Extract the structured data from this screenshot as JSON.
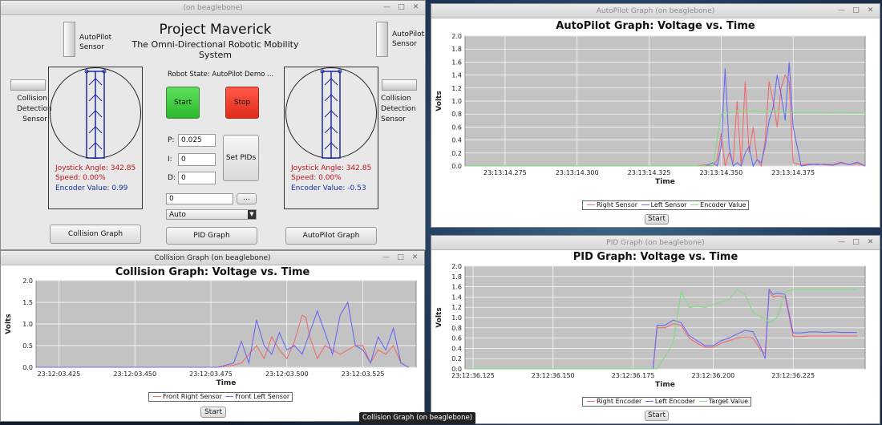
{
  "main": {
    "window_title": "(on beaglebone)",
    "title": "Project Maverick",
    "subtitle": "The Omni-Directional Robotic Mobility System",
    "left_sensor_label": "AutoPilot\nSensor",
    "right_sensor_label": "AutoPilot\nSensor",
    "collision_left": "Collision\nDetection\nSensor",
    "collision_right": "Collision\nDetection\nSensor",
    "robot_state": "Robot State: AutoPilot Demo ...",
    "start_label": "Start",
    "stop_label": "Stop",
    "p_label": "P:",
    "p_value": "0.025",
    "i_label": "I:",
    "i_value": "0",
    "d_label": "D:",
    "d_value": "0",
    "set_pids": "Set PIDs",
    "command_value": "0",
    "ellipsis": "...",
    "mode_value": "Auto",
    "left_joystick": "Joystick Angle: 342.85",
    "left_speed": "Speed: 0.00%",
    "left_encoder": "Encoder Value: 0.99",
    "right_joystick": "Joystick Angle: 342.85",
    "right_speed": "Speed: 0.00%",
    "right_encoder": "Encoder Value: -0.53",
    "collision_graph_btn": "Collision Graph",
    "pid_graph_btn": "PID Graph",
    "autopilot_graph_btn": "AutoPilot Graph"
  },
  "autopilot_window": {
    "title": "AutoPilot Graph (on beaglebone)",
    "start_label": "Start"
  },
  "pid_window": {
    "title": "PID Graph (on beaglebone)",
    "start_label": "Start"
  },
  "collision_window": {
    "title": "Collision Graph (on beaglebone)",
    "start_label": "Start"
  },
  "taskbar_tooltip": "Collision Graph (on beaglebone)",
  "colors": {
    "red": "#f06c6c",
    "blue": "#6a6af5",
    "green": "#7ce07c",
    "plot_bg": "#c3c3c3"
  },
  "chart_data": [
    {
      "id": "autopilot",
      "type": "line",
      "title": "AutoPilot Graph: Voltage vs. Time",
      "xlabel": "Time",
      "ylabel": "Volts",
      "ylim": [
        0,
        2.0
      ],
      "yticks": [
        "0.0",
        "0.2",
        "0.4",
        "0.6",
        "0.8",
        "1.0",
        "1.2",
        "1.4",
        "1.6",
        "1.8",
        "2.0"
      ],
      "xticks": [
        "23:13:14.275",
        "23:13:14.300",
        "23:13:14.325",
        "23:13:14.350",
        "23:13:14.375"
      ],
      "xlim": [
        0,
        100
      ],
      "xtick_pos": [
        10,
        28,
        46,
        64,
        82
      ],
      "series": [
        {
          "name": "Right Sensor",
          "color": "#f06c6c",
          "x": [
            0,
            55,
            58,
            60,
            62,
            63,
            64,
            65,
            66,
            67,
            68,
            69,
            70,
            71,
            72,
            73,
            74,
            75,
            76,
            77,
            78,
            79,
            80,
            81,
            82,
            84,
            86,
            88,
            90,
            92,
            94,
            96,
            98,
            100
          ],
          "y": [
            0,
            0,
            0,
            0.02,
            0,
            0.1,
            0.5,
            0,
            0.2,
            0.05,
            1.0,
            0,
            1.3,
            0.2,
            0.6,
            0.1,
            0,
            0.4,
            1.3,
            1.0,
            0.6,
            1.2,
            1.4,
            1.3,
            0.05,
            0.02,
            0.03,
            0.02,
            0.03,
            0.02,
            0.06,
            0.02,
            0.04,
            0
          ]
        },
        {
          "name": "Left Sensor",
          "color": "#6a6af5",
          "x": [
            0,
            55,
            60,
            62,
            63,
            64,
            65,
            66,
            67,
            68,
            69,
            70,
            71,
            72,
            73,
            74,
            75,
            76,
            77,
            78,
            79,
            80,
            81,
            82,
            84,
            86,
            88,
            90,
            92,
            94,
            96,
            98,
            100
          ],
          "y": [
            0,
            0,
            0,
            0.05,
            0,
            0.3,
            1.5,
            0.3,
            0,
            0.05,
            0,
            0.2,
            0.3,
            0,
            0.1,
            0.05,
            0.3,
            0.7,
            0.9,
            1.4,
            1.1,
            0.7,
            1.6,
            0.6,
            0,
            0.02,
            0.03,
            0.02,
            0.01,
            0.05,
            0.02,
            0.06,
            0
          ]
        },
        {
          "name": "Encoder Value",
          "color": "#7ce07c",
          "x": [
            0,
            55,
            58,
            60,
            62,
            64,
            66,
            68,
            70,
            72,
            74,
            76,
            78,
            80,
            82,
            84,
            86,
            88,
            90,
            92,
            94,
            96,
            98,
            100
          ],
          "y": [
            0,
            0,
            0,
            0,
            0,
            0.8,
            0.82,
            0.85,
            0.84,
            0.85,
            0.83,
            0.85,
            0.84,
            0.83,
            0.82,
            0.83,
            0.82,
            0.83,
            0.82,
            0.82,
            0.83,
            0.82,
            0.82,
            0.82
          ]
        }
      ]
    },
    {
      "id": "pid",
      "type": "line",
      "title": "PID Graph: Voltage vs. Time",
      "xlabel": "Time",
      "ylabel": "Volts",
      "ylim": [
        0,
        2.0
      ],
      "yticks": [
        "0.0",
        "0.2",
        "0.4",
        "0.6",
        "0.8",
        "1.0",
        "1.2",
        "1.4",
        "1.6",
        "1.8",
        "2.0"
      ],
      "xticks": [
        "23:12:36.125",
        "23:12:36.150",
        "23:12:36.175",
        "23:12:36.200",
        "23:12:36.225"
      ],
      "xlim": [
        0,
        100
      ],
      "xtick_pos": [
        2,
        22,
        42,
        62,
        82
      ],
      "series": [
        {
          "name": "Right Encoder",
          "color": "#f06c6c",
          "x": [
            0,
            47,
            48,
            50,
            52,
            54,
            56,
            58,
            60,
            62,
            64,
            66,
            68,
            70,
            72,
            74,
            75,
            76,
            77,
            78,
            80,
            82,
            84,
            86,
            88,
            90,
            92,
            94,
            96,
            98
          ],
          "y": [
            0,
            0,
            0.8,
            0.8,
            0.88,
            0.85,
            0.6,
            0.5,
            0.42,
            0.42,
            0.5,
            0.55,
            0.6,
            0.62,
            0.6,
            0.35,
            0.3,
            1.5,
            1.4,
            1.42,
            1.4,
            0.63,
            0.63,
            0.64,
            0.64,
            0.64,
            0.64,
            0.64,
            0.64,
            0.64
          ]
        },
        {
          "name": "Left Encoder",
          "color": "#6a6af5",
          "x": [
            0,
            47,
            48,
            50,
            52,
            54,
            56,
            58,
            60,
            62,
            64,
            66,
            68,
            70,
            72,
            74,
            75,
            76,
            77,
            78,
            80,
            82,
            84,
            86,
            88,
            90,
            92,
            94,
            96,
            98
          ],
          "y": [
            0,
            0,
            0.85,
            0.85,
            0.95,
            0.9,
            0.65,
            0.55,
            0.45,
            0.45,
            0.55,
            0.6,
            0.68,
            0.75,
            0.72,
            0.4,
            0.2,
            1.55,
            1.45,
            1.48,
            1.45,
            0.7,
            0.7,
            0.72,
            0.72,
            0.71,
            0.72,
            0.71,
            0.71,
            0.71
          ]
        },
        {
          "name": "Target Value",
          "color": "#7ce07c",
          "x": [
            0,
            47,
            48,
            52,
            54,
            56,
            58,
            60,
            62,
            64,
            66,
            68,
            70,
            72,
            74,
            75,
            76,
            78,
            80,
            82,
            84,
            86,
            88,
            90,
            92,
            94,
            96,
            98
          ],
          "y": [
            0,
            0,
            0,
            0.5,
            1.5,
            1.2,
            1.22,
            1.2,
            1.25,
            1.3,
            1.35,
            1.55,
            1.45,
            1.1,
            1.0,
            1.0,
            0.9,
            1.0,
            1.5,
            1.55,
            1.55,
            1.55,
            1.55,
            1.55,
            1.55,
            1.55,
            1.55,
            1.55
          ]
        }
      ]
    },
    {
      "id": "collision",
      "type": "line",
      "title": "Collision Graph: Voltage vs. Time",
      "xlabel": "Time",
      "ylabel": "Volts",
      "ylim": [
        0,
        2.0
      ],
      "yticks": [
        "0.0",
        "0.5",
        "1.0",
        "1.5",
        "2.0"
      ],
      "xticks": [
        "23:12:03.425",
        "23:12:03.450",
        "23:12:03.475",
        "23:12:03.500",
        "23:12:03.525"
      ],
      "xlim": [
        0,
        100
      ],
      "xtick_pos": [
        6,
        26,
        46,
        66,
        86
      ],
      "series": [
        {
          "name": "Front Right Sensor",
          "color": "#f06c6c",
          "x": [
            0,
            48,
            52,
            54,
            56,
            58,
            60,
            62,
            64,
            66,
            68,
            70,
            71,
            72,
            74,
            76,
            78,
            80,
            82,
            84,
            86,
            88,
            90,
            92,
            94,
            96,
            98
          ],
          "y": [
            0,
            0,
            0.05,
            0.1,
            0.3,
            0.5,
            0.2,
            0.7,
            0.4,
            0.2,
            0.6,
            1.2,
            1.15,
            0.7,
            0.2,
            0.5,
            0.4,
            0.3,
            0.4,
            0.5,
            0.5,
            0.1,
            0.4,
            0.3,
            0.5,
            0.1,
            0
          ]
        },
        {
          "name": "Front Left Sensor",
          "color": "#6a6af5",
          "x": [
            0,
            48,
            52,
            54,
            56,
            58,
            60,
            62,
            64,
            66,
            68,
            70,
            72,
            74,
            76,
            78,
            80,
            82,
            84,
            86,
            88,
            90,
            92,
            94,
            96,
            98
          ],
          "y": [
            0,
            0,
            0.1,
            0.6,
            0.1,
            1.1,
            0.5,
            0.3,
            0.8,
            0.4,
            0.5,
            0.3,
            0.8,
            1.3,
            0.8,
            0.3,
            1.2,
            1.5,
            0.5,
            0.4,
            0.1,
            0.7,
            0.4,
            0.9,
            0.1,
            0
          ]
        }
      ]
    }
  ]
}
